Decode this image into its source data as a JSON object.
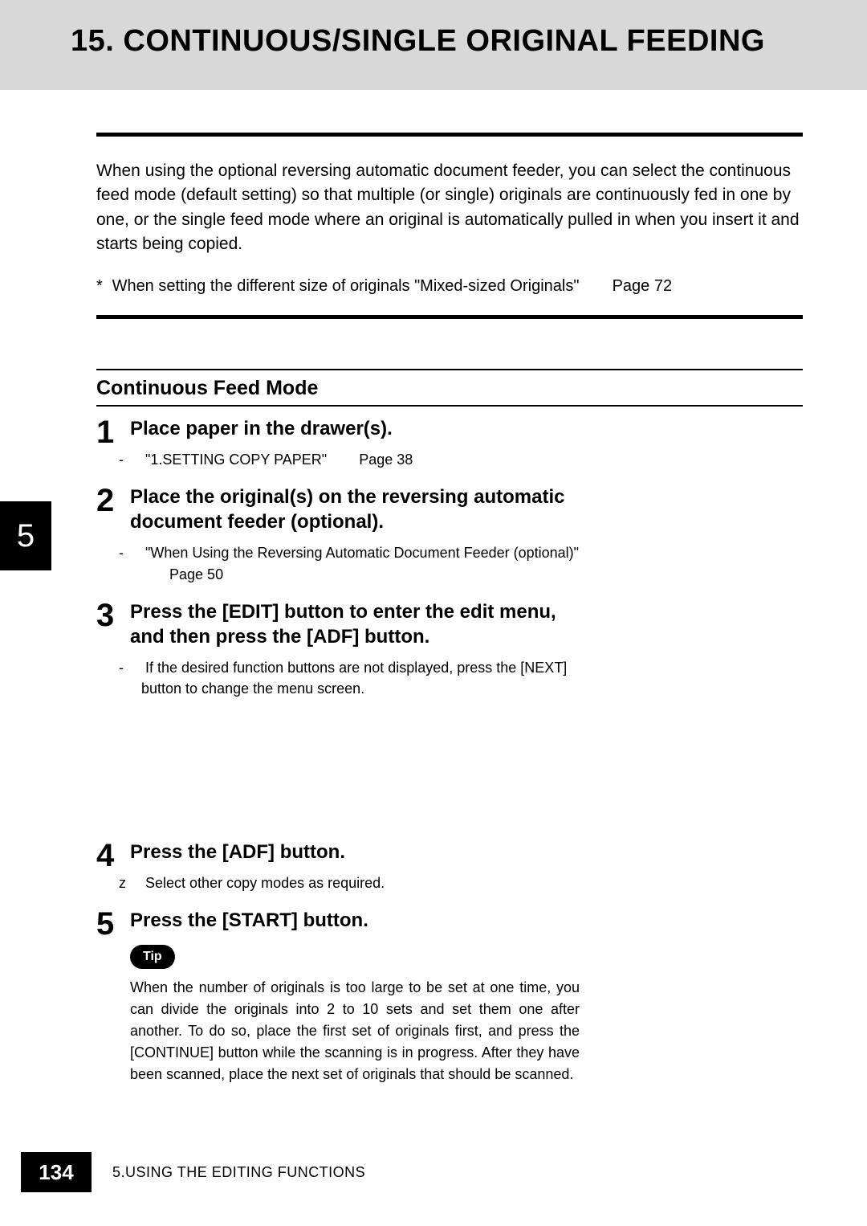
{
  "header": {
    "title": "15. CONTINUOUS/SINGLE ORIGINAL FEEDING"
  },
  "intro": "When using the optional reversing automatic document feeder, you can select the continuous feed mode (default setting) so that multiple (or single) originals are continuously fed in one by one, or the single feed mode where an original is automatically pulled in when you insert it and starts being copied.",
  "footnote": {
    "text": "When setting the different size of originals \"Mixed-sized Originals\"",
    "ref": "Page 72"
  },
  "subsection_title": "Continuous Feed Mode",
  "chapter_tab": "5",
  "steps": [
    {
      "num": "1",
      "title": "Place paper in the drawer(s).",
      "notes": [
        {
          "kind": "dash",
          "text": "\"1.SETTING COPY PAPER\"",
          "ref": "Page 38"
        }
      ]
    },
    {
      "num": "2",
      "title": "Place the original(s) on the reversing automatic document feeder (optional).",
      "notes": [
        {
          "kind": "dash",
          "text": "\"When Using the Reversing Automatic Document Feeder (optional)\"",
          "ref": "Page 50"
        }
      ]
    },
    {
      "num": "3",
      "title": "Press the [EDIT] button to enter the edit menu, and then press the [ADF] button.",
      "notes": [
        {
          "kind": "dash",
          "text": "If the desired function buttons are not displayed, press the [NEXT] button to change the menu screen."
        }
      ]
    },
    {
      "num": "4",
      "title": "Press the [ADF] button.",
      "notes": [
        {
          "kind": "z",
          "text": "Select other copy modes as required."
        }
      ]
    },
    {
      "num": "5",
      "title": "Press the [START] button.",
      "tip": {
        "label": "Tip",
        "text": "When the number of originals is too large to be set at one time, you can divide the originals into 2 to 10 sets and set them one after another. To do so, place the first set of originals first, and press the [CONTINUE] button while the scanning is in progress. After they have been scanned, place the next set of originals that should be scanned."
      }
    }
  ],
  "footer": {
    "page_number": "134",
    "text": "5.USING THE EDITING FUNCTIONS"
  }
}
